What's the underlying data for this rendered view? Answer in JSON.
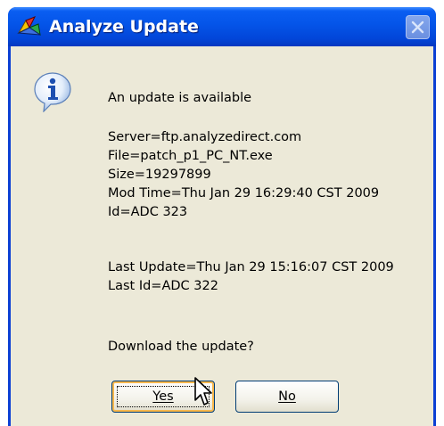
{
  "window": {
    "title": "Analyze Update"
  },
  "dialog": {
    "heading": "An update is available",
    "details": [
      "Server=ftp.analyzedirect.com",
      "File=patch_p1_PC_NT.exe",
      "Size=19297899",
      "Mod Time=Thu Jan 29 16:29:40 CST 2009",
      "Id=ADC 323"
    ],
    "last_update": [
      "Last Update=Thu Jan 29 15:16:07 CST 2009",
      "Last Id=ADC 322"
    ],
    "prompt": "Download the update?"
  },
  "buttons": {
    "yes_label": "Yes",
    "no_label": "No"
  },
  "icons": {
    "app": "analyze-app-icon",
    "info": "information-icon",
    "close": "close-icon",
    "cursor": "mouse-pointer-icon"
  },
  "colors": {
    "titlebar": "#0454e8",
    "client": "#ece9d8",
    "default_button_highlight": "#f8b84d"
  }
}
